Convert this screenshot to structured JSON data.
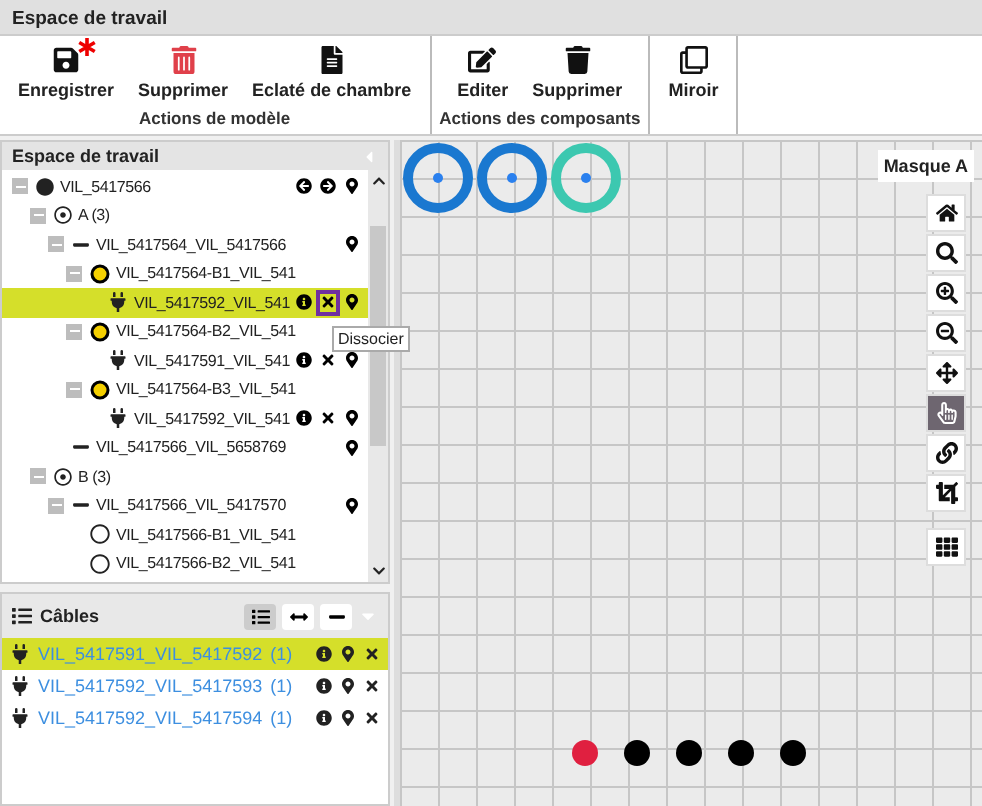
{
  "window": {
    "title": "Espace de travail"
  },
  "toolbar": {
    "groups": [
      {
        "caption": "Actions de modèle",
        "buttons": [
          {
            "kind": "save",
            "label": "Enregistrer",
            "unsaved": true
          },
          {
            "kind": "delete",
            "label": "Supprimer"
          },
          {
            "kind": "explode",
            "label": "Eclaté de chambre"
          }
        ]
      },
      {
        "caption": "Actions des composants",
        "buttons": [
          {
            "kind": "edit",
            "label": "Editer"
          },
          {
            "kind": "trash",
            "label": "Supprimer"
          }
        ]
      },
      {
        "buttons": [
          {
            "kind": "mirror",
            "label": "Miroir"
          }
        ]
      }
    ]
  },
  "tree_panel": {
    "title": "Espace de travail",
    "tooltip": "Dissocier",
    "nodes": [
      {
        "label": "VIL_5417566",
        "kind": "filled",
        "expanded": true,
        "selected": false,
        "actions": [
          {
            "kind": "prev",
            "focused": false
          },
          {
            "kind": "next",
            "focused": false
          },
          {
            "kind": "pin",
            "focused": false
          }
        ],
        "children": [
          {
            "label": "A (3)",
            "kind": "target",
            "expanded": true,
            "selected": false,
            "children": [
              {
                "label": "VIL_5417564_VIL_5417566",
                "kind": "dash",
                "expanded": true,
                "selected": false,
                "actions": [
                  {
                    "kind": "pin",
                    "focused": false
                  }
                ],
                "children": [
                  {
                    "label": "VIL_5417564-B1_VIL_541",
                    "kind": "yellow",
                    "expanded": true,
                    "selected": false,
                    "children": [
                      {
                        "label": "VIL_5417592_VIL_541",
                        "kind": "plug",
                        "selected": true,
                        "actions": [
                          {
                            "kind": "info",
                            "focused": false
                          },
                          {
                            "kind": "unlink",
                            "focused": true
                          },
                          {
                            "kind": "pin",
                            "focused": false
                          }
                        ]
                      }
                    ]
                  },
                  {
                    "label": "VIL_5417564-B2_VIL_541",
                    "kind": "yellow",
                    "expanded": true,
                    "selected": false,
                    "children": [
                      {
                        "label": "VIL_5417591_VIL_541",
                        "kind": "plug",
                        "selected": false,
                        "actions": [
                          {
                            "kind": "info",
                            "focused": false
                          },
                          {
                            "kind": "unlink",
                            "focused": false
                          },
                          {
                            "kind": "pin",
                            "focused": false
                          }
                        ]
                      }
                    ]
                  },
                  {
                    "label": "VIL_5417564-B3_VIL_541",
                    "kind": "yellow",
                    "expanded": true,
                    "selected": false,
                    "children": [
                      {
                        "label": "VIL_5417592_VIL_541",
                        "kind": "plug",
                        "selected": false,
                        "actions": [
                          {
                            "kind": "info",
                            "focused": false
                          },
                          {
                            "kind": "unlink",
                            "focused": false
                          },
                          {
                            "kind": "pin",
                            "focused": false
                          }
                        ]
                      }
                    ]
                  }
                ]
              },
              {
                "label": "VIL_5417566_VIL_5658769",
                "kind": "dash",
                "selected": false,
                "actions": [
                  {
                    "kind": "pin",
                    "focused": false
                  }
                ]
              }
            ]
          },
          {
            "label": "B (3)",
            "kind": "target",
            "expanded": true,
            "selected": false,
            "children": [
              {
                "label": "VIL_5417566_VIL_5417570",
                "kind": "dash",
                "expanded": true,
                "selected": false,
                "actions": [
                  {
                    "kind": "pin",
                    "focused": false
                  }
                ],
                "children": [
                  {
                    "label": "VIL_5417566-B1_VIL_541",
                    "kind": "empty",
                    "selected": false
                  },
                  {
                    "label": "VIL_5417566-B2_VIL_541",
                    "kind": "empty",
                    "selected": false
                  }
                ]
              }
            ]
          }
        ]
      }
    ]
  },
  "cables_panel": {
    "title": "Câbles",
    "views": [
      {
        "kind": "list",
        "selected": true
      },
      {
        "kind": "width",
        "selected": false
      },
      {
        "kind": "line",
        "selected": false
      }
    ],
    "rows": [
      {
        "label": "VIL_5417591_VIL_5417592",
        "count": "(1)",
        "selected": true
      },
      {
        "label": "VIL_5417592_VIL_5417593",
        "count": "(1)",
        "selected": false
      },
      {
        "label": "VIL_5417592_VIL_5417594",
        "count": "(1)",
        "selected": false
      }
    ]
  },
  "canvas": {
    "mask_label": "Masque A",
    "rings": [
      {
        "color": "#1a78d0"
      },
      {
        "color": "#1a78d0"
      },
      {
        "color": "#3cc8b0"
      }
    ],
    "dots": [
      {
        "color": "#e02040"
      },
      {
        "color": "#000000"
      },
      {
        "color": "#000000"
      },
      {
        "color": "#000000"
      },
      {
        "color": "#000000"
      }
    ],
    "tools": [
      {
        "kind": "home",
        "selected": false
      },
      {
        "kind": "search",
        "selected": false
      },
      {
        "kind": "zoom-in",
        "selected": false
      },
      {
        "kind": "zoom-out",
        "selected": false
      },
      {
        "kind": "move",
        "selected": false
      },
      {
        "kind": "hand",
        "selected": true
      },
      {
        "kind": "link",
        "selected": false
      },
      {
        "kind": "crop",
        "selected": false
      },
      {
        "kind": "grid",
        "selected": false
      }
    ]
  }
}
